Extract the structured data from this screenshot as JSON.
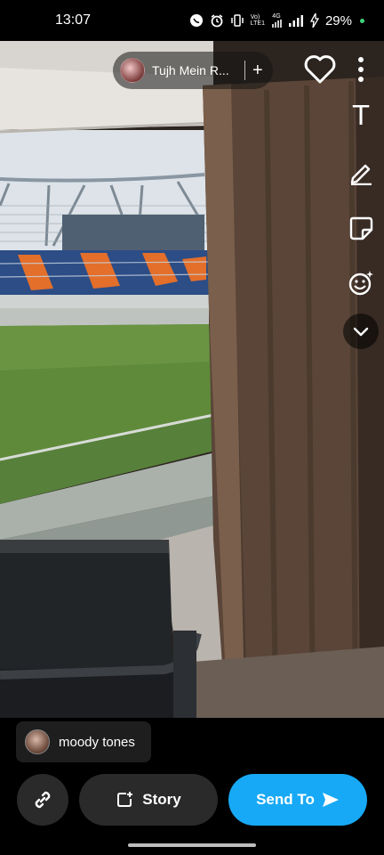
{
  "status_bar": {
    "time": "13:07",
    "network_top": "Vo)",
    "network_bottom": "LTE1",
    "network_type": "4G",
    "battery": "29%",
    "icons": [
      "whatsapp-icon",
      "alarm-icon",
      "vibrate-icon",
      "wifi-icon",
      "signal-icon",
      "charging-icon"
    ]
  },
  "music": {
    "title": "Tujh Mein R...",
    "add_label": "+"
  },
  "tools": {
    "text_label": "T",
    "icons": [
      "heart-icon",
      "more-icon",
      "text-tool-icon",
      "pen-icon",
      "sticker-icon",
      "lens-icon",
      "chevron-down-icon"
    ]
  },
  "filter": {
    "label": "moody tones"
  },
  "actions": {
    "story_label": "Story",
    "send_label": "Send To"
  },
  "colors": {
    "send_button": "#17a9f5",
    "dark_button": "#2a2a2a",
    "status_dot": "#3fd37a"
  }
}
